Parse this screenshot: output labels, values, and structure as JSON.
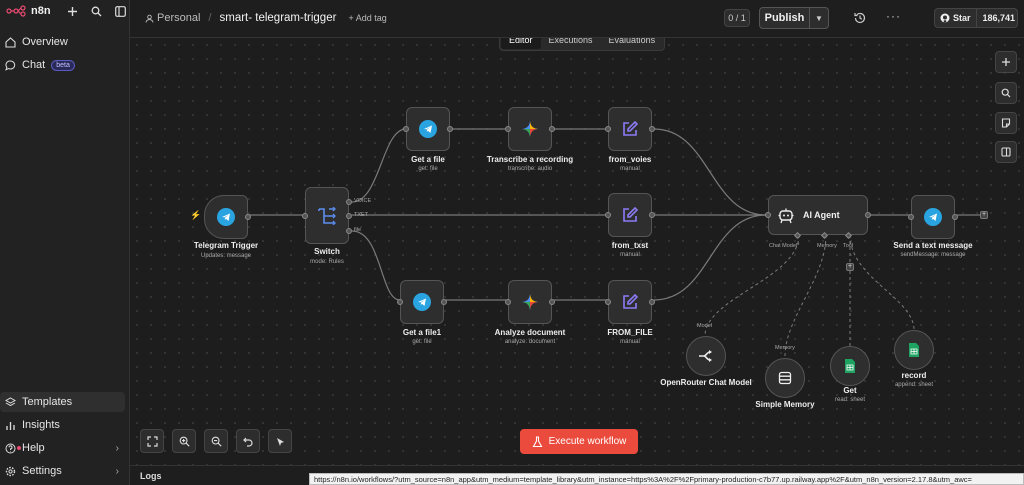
{
  "app": {
    "name": "n8n"
  },
  "sidebar": {
    "items": [
      {
        "label": "Overview"
      },
      {
        "label": "Chat",
        "badge": "beta"
      }
    ],
    "bottom_items": [
      {
        "label": "Templates"
      },
      {
        "label": "Insights"
      },
      {
        "label": "Help"
      },
      {
        "label": "Settings"
      }
    ]
  },
  "header": {
    "project": "Personal",
    "workflow_title": "smart- telegram-trigger",
    "add_tag": "+ Add tag",
    "counter": "0 / 1",
    "publish_label": "Publish",
    "github_star": "Star",
    "github_count": "186,741"
  },
  "tabs": [
    {
      "label": "Editor",
      "active": true
    },
    {
      "label": "Executions",
      "active": false
    },
    {
      "label": "Evaluations",
      "active": false
    }
  ],
  "nodes": {
    "telegram_trigger": {
      "title": "Telegram Trigger",
      "sub": "Updates: message"
    },
    "switch": {
      "title": "Switch",
      "sub": "mode: Rules",
      "outputs": [
        "VOICE",
        "TXET",
        "file"
      ]
    },
    "get_file": {
      "title": "Get a file",
      "sub": "get: file"
    },
    "transcribe": {
      "title": "Transcribe a recording",
      "sub": "transcribe: audio"
    },
    "from_voies": {
      "title": "from_voies",
      "sub": "manual"
    },
    "from_txst": {
      "title": "from_txst",
      "sub": "manual"
    },
    "get_file1": {
      "title": "Get a file1",
      "sub": "get: file"
    },
    "analyze": {
      "title": "Analyze document",
      "sub": "analyze: document"
    },
    "from_file": {
      "title": "FROM_FILE",
      "sub": "manual"
    },
    "ai_agent": {
      "title": "AI Agent",
      "ports": [
        "Chat Model*",
        "Memory",
        "Tool"
      ]
    },
    "send_text": {
      "title": "Send a text message",
      "sub": "sendMessage: message"
    },
    "openrouter": {
      "title": "OpenRouter Chat Model",
      "port": "Model"
    },
    "memory": {
      "title": "Simple Memory",
      "port": "Memory"
    },
    "get": {
      "title": "Get",
      "sub": "read: sheet"
    },
    "record": {
      "title": "record",
      "sub": "append: sheet"
    }
  },
  "execute_label": "Execute workflow",
  "logs_label": "Logs",
  "status_url": "https://n8n.io/workflows/?utm_source=n8n_app&utm_medium=template_library&utm_instance=https%3A%2F%2Fprimary-production-c7b77.up.railway.app%2F&utm_n8n_version=2.17.8&utm_awc=",
  "colors": {
    "accent": "#ea4b3c",
    "telegram": "#2aa4e0",
    "edit": "#8b7cf6",
    "sheets": "#1ea362"
  },
  "icons": [
    "telegram-icon",
    "switch-icon",
    "gemini-icon",
    "edit-icon",
    "robot-icon",
    "openrouter-icon",
    "database-icon",
    "sheets-icon"
  ]
}
